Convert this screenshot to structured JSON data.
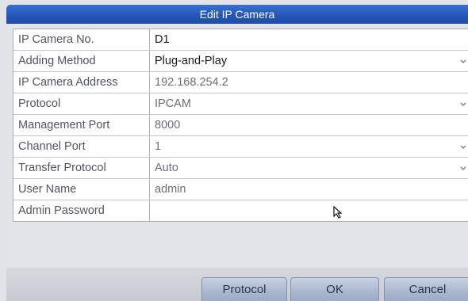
{
  "window": {
    "title": "Edit IP Camera"
  },
  "form": {
    "rows": [
      {
        "label": "IP Camera No.",
        "value": "D1",
        "dropdown": false
      },
      {
        "label": "Adding Method",
        "value": "Plug-and-Play",
        "dropdown": true
      },
      {
        "label": "IP Camera Address",
        "value": "192.168.254.2",
        "dropdown": false
      },
      {
        "label": "Protocol",
        "value": "IPCAM",
        "dropdown": true
      },
      {
        "label": "Management Port",
        "value": "8000",
        "dropdown": false
      },
      {
        "label": "Channel Port",
        "value": "1",
        "dropdown": true
      },
      {
        "label": "Transfer Protocol",
        "value": "Auto",
        "dropdown": true
      },
      {
        "label": "User Name",
        "value": "admin",
        "dropdown": false
      },
      {
        "label": "Admin Password",
        "value": "",
        "dropdown": false
      }
    ]
  },
  "buttons": {
    "protocol": "Protocol",
    "ok": "OK",
    "cancel": "Cancel"
  },
  "icons": {
    "dropdown": "chevron-down-icon",
    "cursor": "mouse-pointer-icon"
  },
  "colors": {
    "title_bar": "#2457b8",
    "button": "#aab6ce"
  }
}
